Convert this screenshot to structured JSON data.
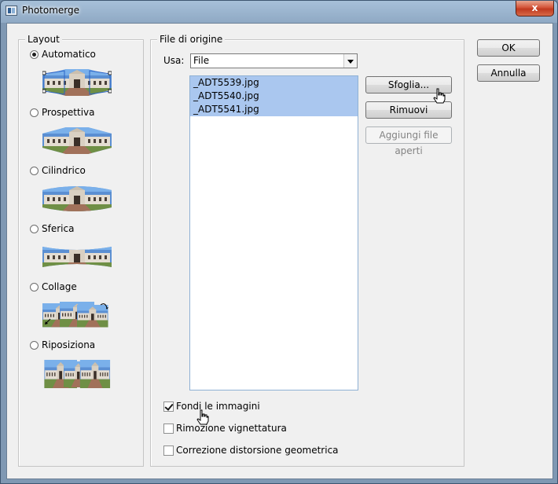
{
  "window": {
    "title": "Photomerge",
    "close_glyph": "x"
  },
  "layout": {
    "legend": "Layout",
    "options": [
      {
        "label": "Automatico",
        "checked": true,
        "icon": "layout-auto-icon"
      },
      {
        "label": "Prospettiva",
        "checked": false,
        "icon": "layout-perspective-icon"
      },
      {
        "label": "Cilindrico",
        "checked": false,
        "icon": "layout-cylindrical-icon"
      },
      {
        "label": "Sferica",
        "checked": false,
        "icon": "layout-spherical-icon"
      },
      {
        "label": "Collage",
        "checked": false,
        "icon": "layout-collage-icon"
      },
      {
        "label": "Riposiziona",
        "checked": false,
        "icon": "layout-reposition-icon"
      }
    ]
  },
  "source": {
    "legend": "File di origine",
    "use_label": "Usa:",
    "use_value": "File",
    "files": [
      "_ADT5539.jpg",
      "_ADT5540.jpg",
      "_ADT5541.jpg"
    ],
    "browse_label": "Sfoglia...",
    "remove_label": "Rimuovi",
    "add_open_label": "Aggiungi file aperti"
  },
  "options": {
    "blend": {
      "label": "Fondi le immagini",
      "checked": true
    },
    "vignette": {
      "label": "Rimozione vignettatura",
      "checked": false
    },
    "distortion": {
      "label": "Correzione distorsione geometrica",
      "checked": false
    }
  },
  "buttons": {
    "ok": "OK",
    "reset": "Annulla"
  },
  "colors": {
    "selection": "#aac7ef",
    "close_red": "#c0391f",
    "title_bar": "#8fa9c4"
  }
}
